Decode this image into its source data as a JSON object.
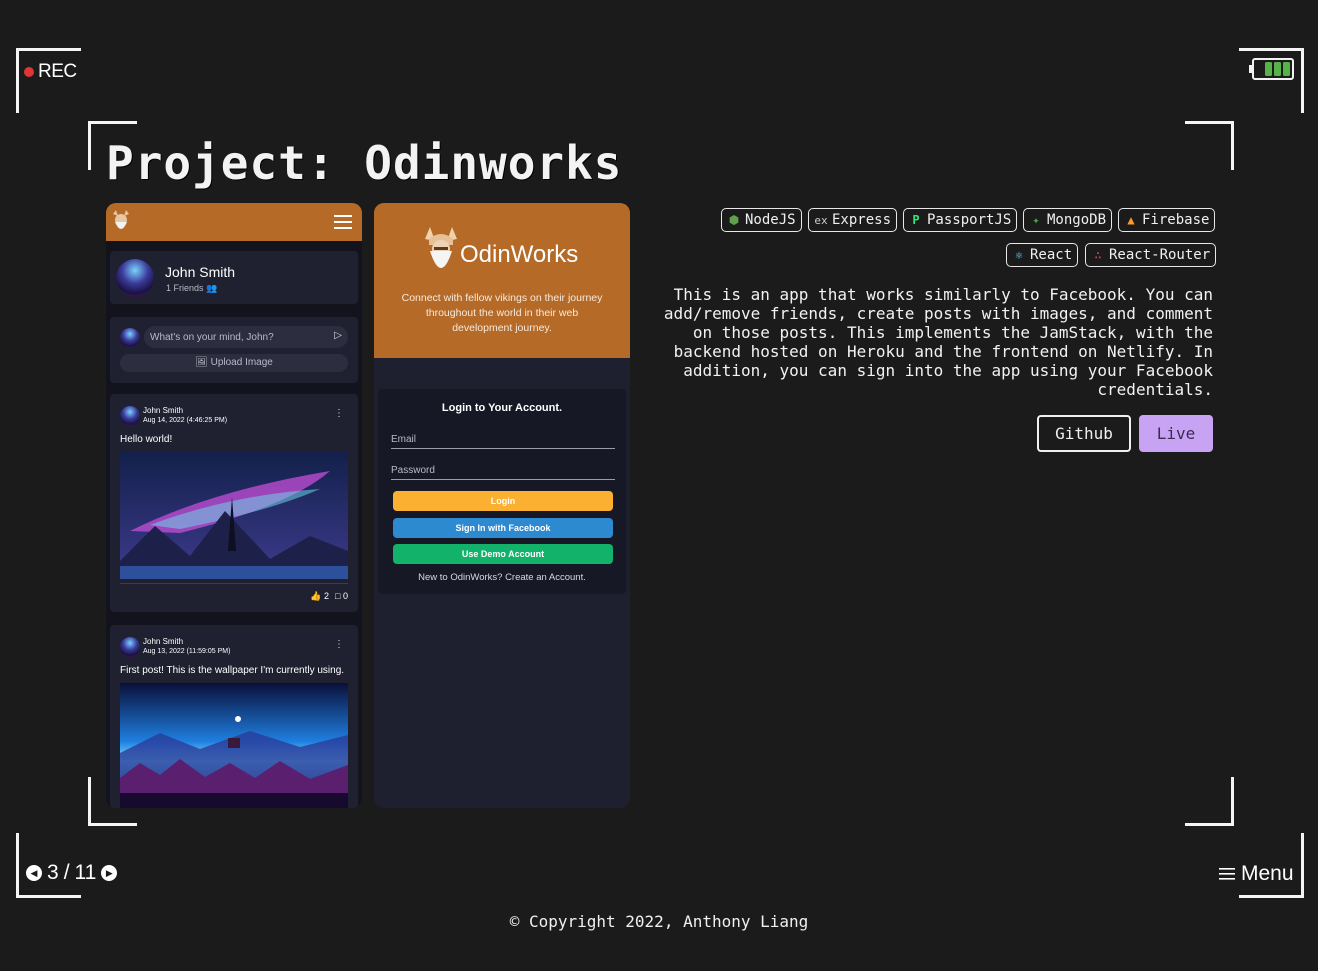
{
  "hud": {
    "rec_label": "REC",
    "battery_icon": "battery-icon"
  },
  "page": {
    "title": "Project: Odinworks"
  },
  "screenshot_feed": {
    "user_name": "John Smith",
    "friends": "1 Friends",
    "composer_placeholder": "What's on your mind, John?",
    "upload_label": "Upload Image",
    "posts": [
      {
        "author": "John Smith",
        "date": "Aug 14, 2022 (4:46:25 PM)",
        "text": "Hello world!",
        "likes": "2",
        "comments": "0"
      },
      {
        "author": "John Smith",
        "date": "Aug 13, 2022 (11:59:05 PM)",
        "text": "First post! This is the wallpaper I'm currently using."
      }
    ]
  },
  "screenshot_login": {
    "brand": "OdinWorks",
    "tagline": "Connect with fellow vikings on their journey throughout the world in their web development journey.",
    "card_title": "Login to Your Account.",
    "email_label": "Email",
    "password_label": "Password",
    "login_button": "Login",
    "facebook_button": "Sign In with Facebook",
    "demo_button": "Use Demo Account",
    "signup_text": "New to OdinWorks? Create an Account."
  },
  "tech_tags": [
    {
      "label": "NodeJS",
      "icon": "nodejs-icon"
    },
    {
      "label": "Express",
      "icon": "express-icon"
    },
    {
      "label": "PassportJS",
      "icon": "passport-icon"
    },
    {
      "label": "MongoDB",
      "icon": "mongodb-icon"
    },
    {
      "label": "Firebase",
      "icon": "firebase-icon"
    },
    {
      "label": "React",
      "icon": "react-icon"
    },
    {
      "label": "React-Router",
      "icon": "react-router-icon"
    }
  ],
  "description": "This is an app that works similarly to Facebook. You can add/remove friends, create posts with images, and comment on those posts. This implements the JamStack, with the backend hosted on Heroku and the frontend on Netlify. In addition, you can sign into the app using your Facebook credentials.",
  "links": {
    "github": "Github",
    "live": "Live"
  },
  "pager": {
    "current": "3",
    "separator": "/",
    "total": "11"
  },
  "menu_label": "Menu",
  "footer": {
    "copyright": "© Copyright 2022, Anthony Liang"
  },
  "colors": {
    "background": "#1b1b1b",
    "accent_orange": "#b56a28",
    "live_button": "#c9a3f3",
    "login_yellow": "#fbb031",
    "facebook_blue": "#2d8ad0",
    "demo_green": "#13b26b",
    "rec_red": "#e03535"
  }
}
